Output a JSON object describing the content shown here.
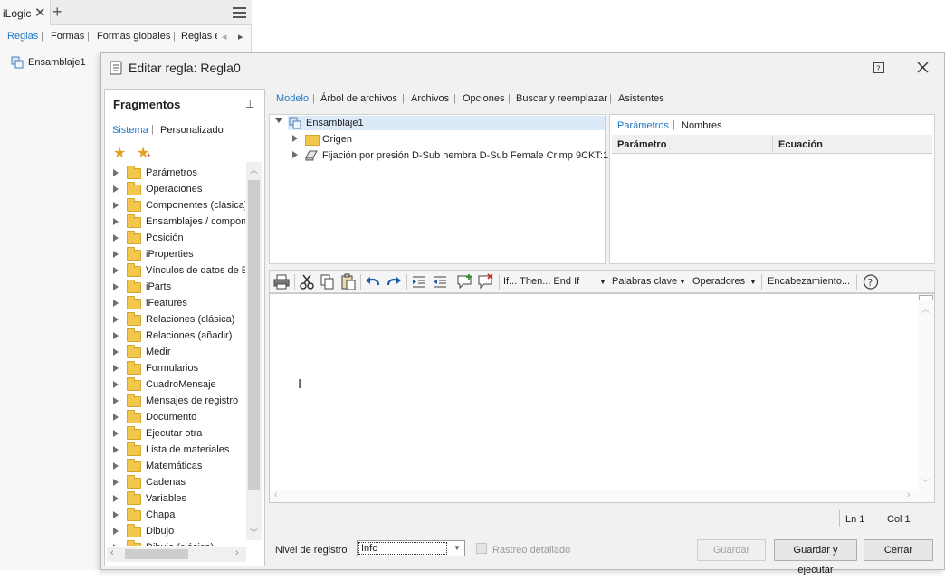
{
  "ilogic_panel": {
    "tab_title": "iLogic",
    "nav": {
      "rules": "Reglas",
      "forms": "Formas",
      "global_forms": "Formas globales",
      "external_rules": "Reglas e"
    },
    "tree_root": "Ensamblaje1"
  },
  "dialog": {
    "title": "Editar regla: Regla0",
    "snippets": {
      "title": "Fragmentos",
      "tab_system": "Sistema",
      "tab_custom": "Personalizado",
      "items": [
        "Parámetros",
        "Operaciones",
        "Componentes (clásica)",
        "Ensamblajes / compone",
        "Posición",
        "iProperties",
        "Vínculos de datos de Ex",
        "iParts",
        "iFeatures",
        "Relaciones (clásica)",
        "Relaciones (añadir)",
        "Medir",
        "Formularios",
        "CuadroMensaje",
        "Mensajes de registro",
        "Documento",
        "Ejecutar otra",
        "Lista de materiales",
        "Matemáticas",
        "Cadenas",
        "Variables",
        "Chapa",
        "Dibujo",
        "Dibujo (clásica)"
      ]
    },
    "tabs": [
      "Modelo",
      "Árbol de archivos",
      "Archivos",
      "Opciones",
      "Buscar y reemplazar",
      "Asistentes"
    ],
    "model_tree": {
      "root": "Ensamblaje1",
      "children": [
        "Origen",
        "Fijación por presión D-Sub hembra D-Sub Female Crimp 9CKT:1"
      ]
    },
    "params": {
      "tab_params": "Parámetros",
      "tab_names": "Nombres",
      "col_param": "Parámetro",
      "col_equation": "Ecuación"
    },
    "toolbar": {
      "if_then": "If... Then... End If",
      "keywords": "Palabras clave",
      "operators": "Operadores",
      "header": "Encabezamiento..."
    },
    "status": {
      "line": "Ln 1",
      "col": "Col 1"
    },
    "bottom": {
      "log_level_label": "Nivel de registro",
      "log_level_value": "Info",
      "verbose_label": "Rastreo detallado",
      "save": "Guardar",
      "save_run": "Guardar y ejecutar",
      "close": "Cerrar"
    }
  },
  "colors": {
    "accent": "#1f78c8",
    "folder": "#f1c84b",
    "selection": "#dce9f7"
  }
}
